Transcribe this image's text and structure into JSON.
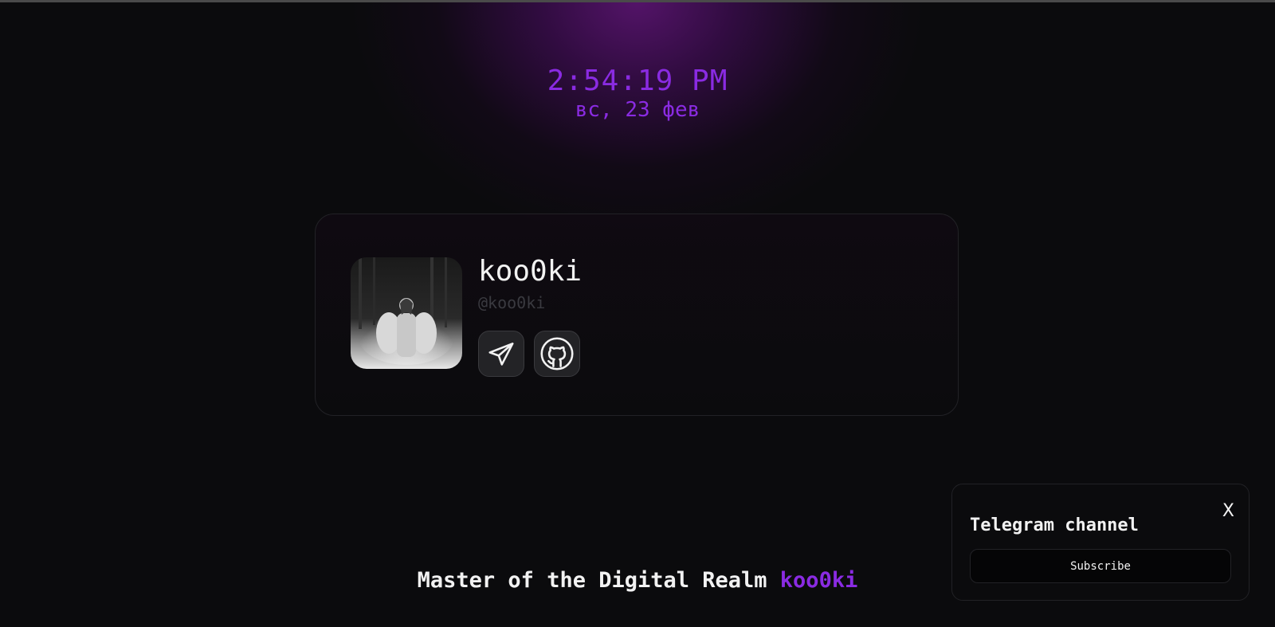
{
  "clock": {
    "time": "2:54:19 PM",
    "date": "вс, 23 фев"
  },
  "profile": {
    "display_name": "koo0ki",
    "handle": "@koo0ki",
    "avatar_icon": "photo-avatar",
    "socials": [
      {
        "icon": "telegram-icon"
      },
      {
        "icon": "github-icon"
      }
    ]
  },
  "tagline": {
    "text": "Master of the Digital Realm ",
    "accent": "koo0ki"
  },
  "popup": {
    "close_label": "X",
    "title": "Telegram channel",
    "button_label": "Subscribe"
  },
  "colors": {
    "accent": "#8a2be2",
    "background": "#0b0b0d",
    "glow": "#3c0c50"
  }
}
